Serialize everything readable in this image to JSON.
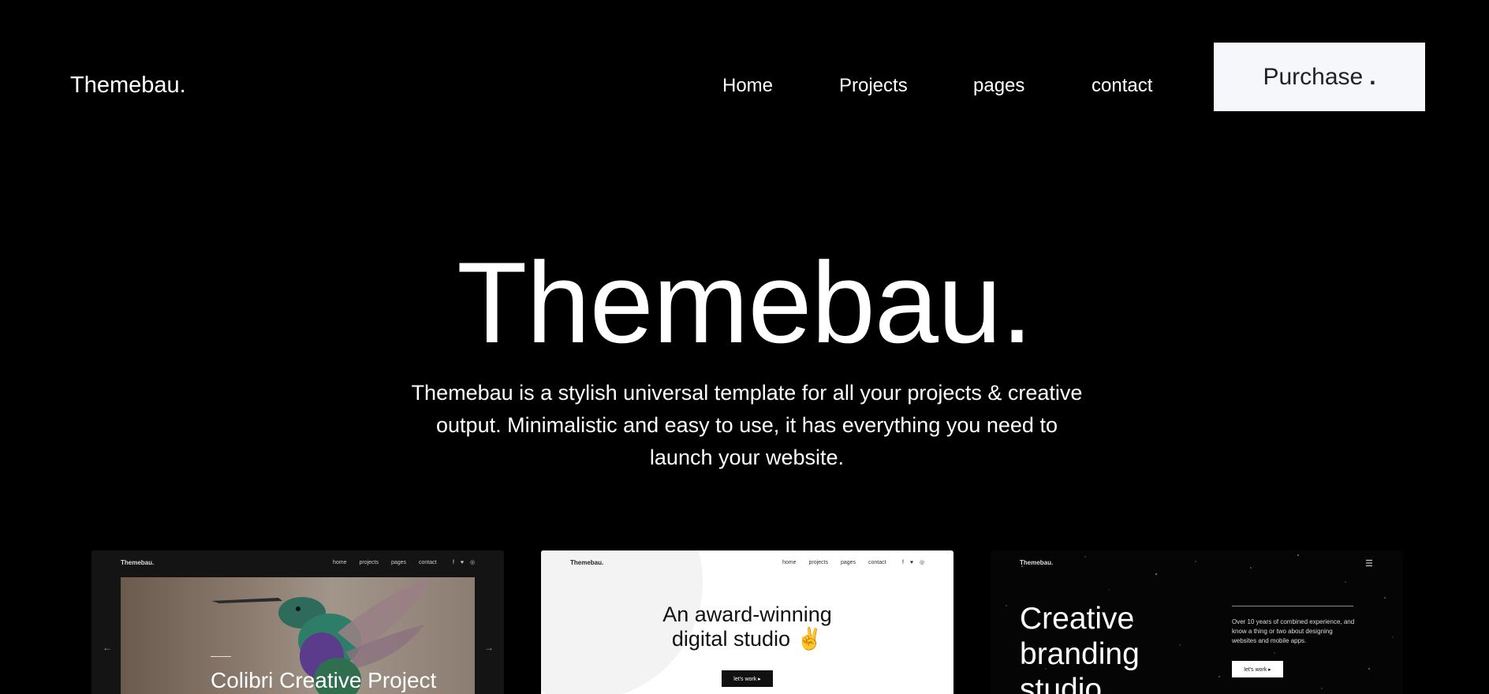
{
  "header": {
    "logo": "Themebau.",
    "nav": [
      "Home",
      "Projects",
      "pages",
      "contact"
    ],
    "purchase_label": "Purchase",
    "purchase_dot": "."
  },
  "hero": {
    "title": "Themebau.",
    "description": "Themebau is a stylish universal template for all your projects & creative output. Minimalistic and easy to use, it has everything you need to launch your website."
  },
  "previews": [
    {
      "logo": "Themebau.",
      "nav": [
        "home",
        "projects",
        "pages",
        "contact"
      ],
      "social": "f ♥ ◎",
      "title": "Colibri Creative Project",
      "prev_arrow": "←",
      "next_arrow": "→"
    },
    {
      "logo": "Themebau.",
      "nav": [
        "home",
        "projects",
        "pages",
        "contact"
      ],
      "social": "f ♥ ◎",
      "title_line1": "An award-winning",
      "title_line2": "digital studio ✌",
      "button": "let's work ▸"
    },
    {
      "logo": "Themebau.",
      "menu_icon": "☰",
      "title": "Creative branding studio",
      "text": "Over 10 years of combined experience, and know a thing or two about designing websites and mobile apps.",
      "button": "let's work ▸"
    }
  ],
  "colors": {
    "background": "#000000",
    "purchase_bg": "#f5f7fa",
    "text": "#ffffff"
  }
}
